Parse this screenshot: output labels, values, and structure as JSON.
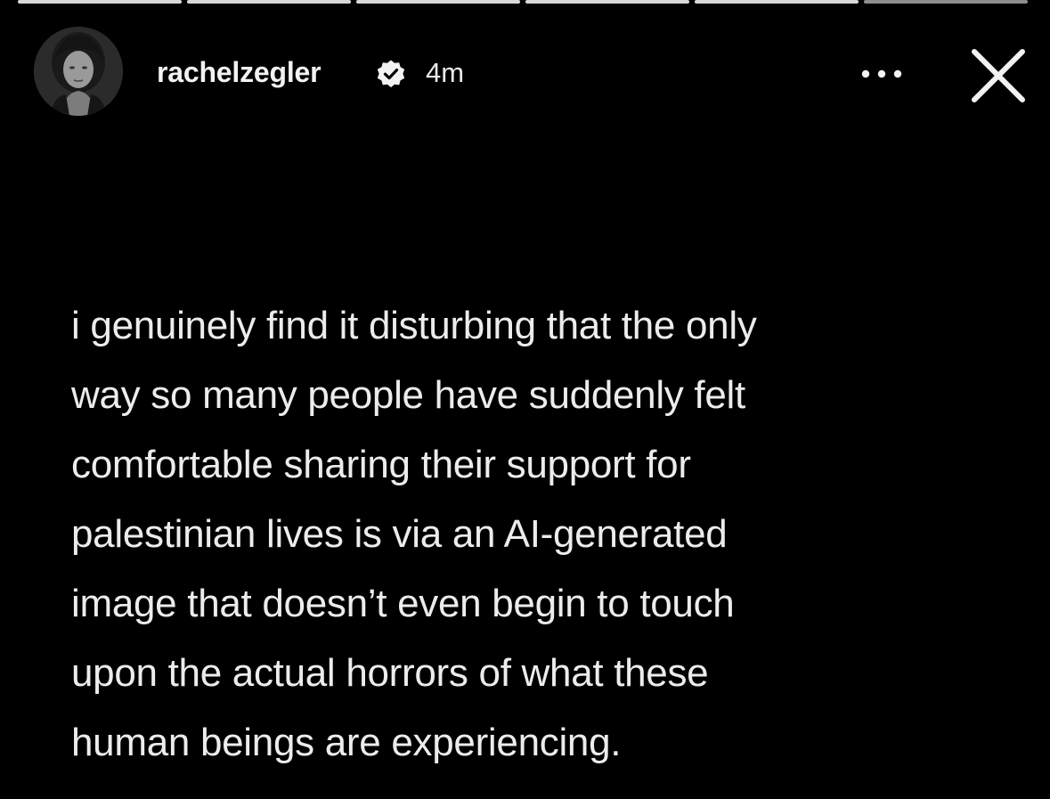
{
  "story": {
    "progress_segments": [
      "done",
      "done",
      "done",
      "done",
      "done",
      "active"
    ],
    "username": "rachelzegler",
    "verified": true,
    "time_ago": "4m",
    "caption_lines": [
      "i genuinely find it disturbing that the only",
      "way so many people have suddenly felt",
      "comfortable sharing their support for",
      "palestinian lives is via an AI-generated",
      "image that doesn’t even begin to touch",
      "upon the actual horrors of what these",
      "human beings are experiencing."
    ]
  },
  "icons": {
    "verified": "verified-badge-icon",
    "more": "more-options-icon",
    "close": "close-icon"
  },
  "colors": {
    "background": "#000000",
    "text": "#ececec",
    "progress_done": "#d8d8d8",
    "progress_pending": "#8d8d8d"
  }
}
